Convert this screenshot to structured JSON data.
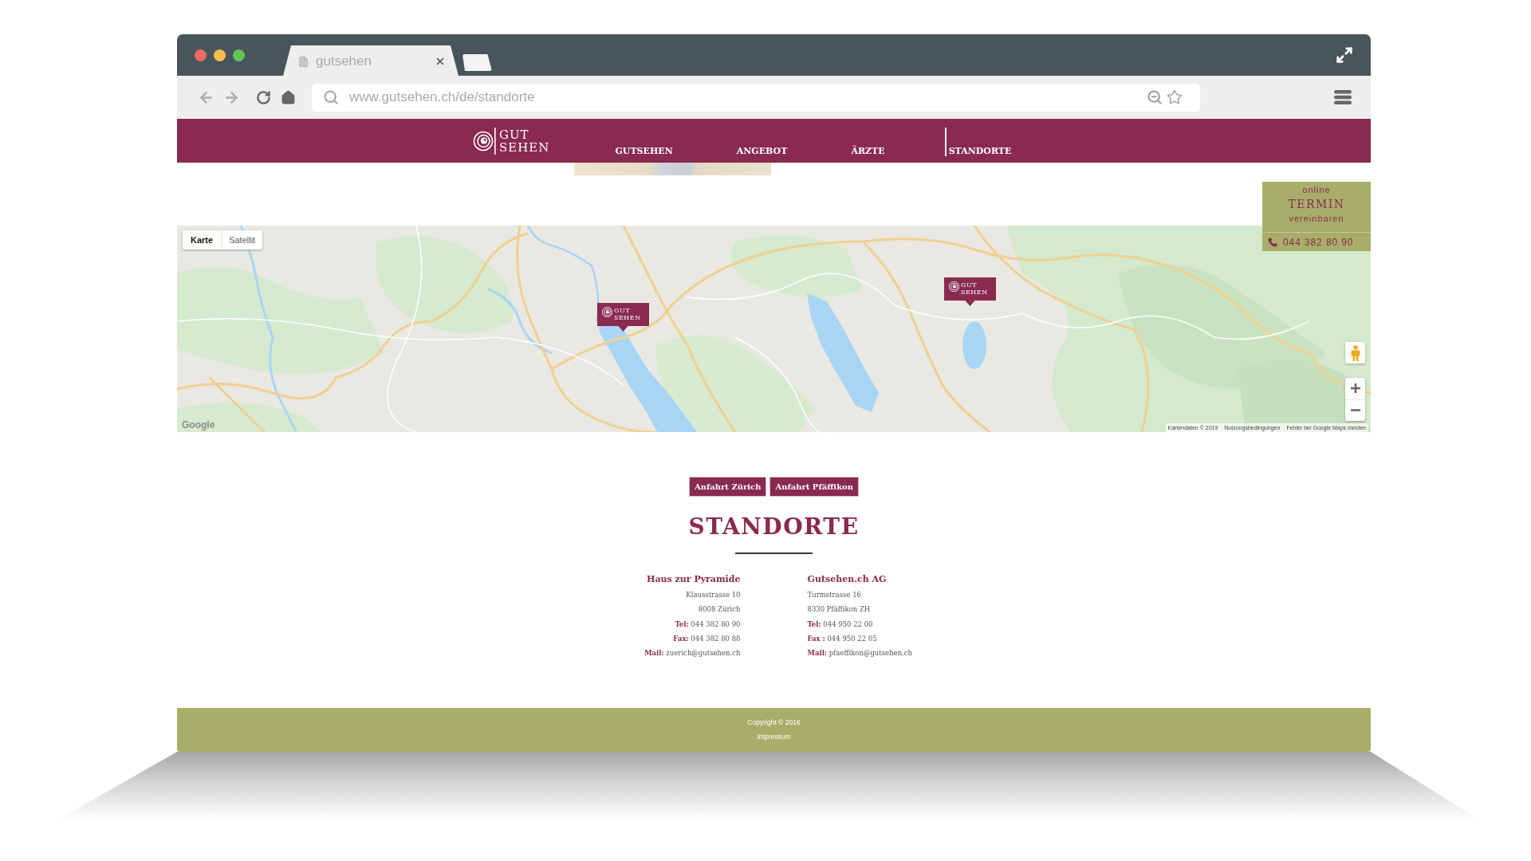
{
  "browser": {
    "tab": {
      "title": "gutsehen"
    },
    "address_bar": {
      "url": "www.gutsehen.ch/de/standorte"
    }
  },
  "site_header": {
    "logo": {
      "words": [
        "GUT",
        "SEHEN"
      ]
    },
    "nav": [
      {
        "label": "GUTSEHEN",
        "selected": false
      },
      {
        "label": "ANGEBOT",
        "selected": false
      },
      {
        "label": "ÄRZTE",
        "selected": false
      },
      {
        "label": "STANDORTE",
        "selected": true
      }
    ]
  },
  "appointment_widget": {
    "lines": [
      {
        "text": "online",
        "kind": "small"
      },
      {
        "text": "TERMIN",
        "kind": "large"
      },
      {
        "text": "vereinbaren",
        "kind": "small"
      }
    ],
    "phone": "044 382 80 90"
  },
  "map": {
    "map_types": [
      {
        "label": "Karte",
        "selected": true
      },
      {
        "label": "Satellit",
        "selected": false
      }
    ],
    "markers": [
      {
        "words": [
          "GUT",
          "SEHEN"
        ]
      },
      {
        "words": [
          "GUT",
          "SEHEN"
        ]
      }
    ],
    "logo": "Google",
    "attribution": [
      "Kartendaten © 2019",
      "Nutzungsbedingungen",
      "Fehler bei Google Maps melden"
    ]
  },
  "direction_buttons": [
    {
      "label": "Anfahrt Zürich"
    },
    {
      "label": "Anfahrt Pfäffikon"
    }
  ],
  "heading": "STANDORTE",
  "locations": [
    {
      "name": "Haus zur Pyramide",
      "lines": [
        "Klausstrasse 10",
        "8008 Zürich",
        "**Tel:** 044 382 80 90",
        "**Fax:** 044 382 80 88",
        "**Mail:** zuerich@gutsehen.ch"
      ]
    },
    {
      "name": "Gutsehen.ch AG",
      "lines": [
        "Turmstrasse 16",
        "8330 Pfäffikon ZH",
        "**Tel:** 044 950 22 00",
        "**Fax :** 044 950 22 05",
        "**Mail:** pfaeffikon@gutsehen.ch"
      ]
    }
  ],
  "footer": {
    "copyright": "Copyright © 2016",
    "link": "Impressum"
  }
}
